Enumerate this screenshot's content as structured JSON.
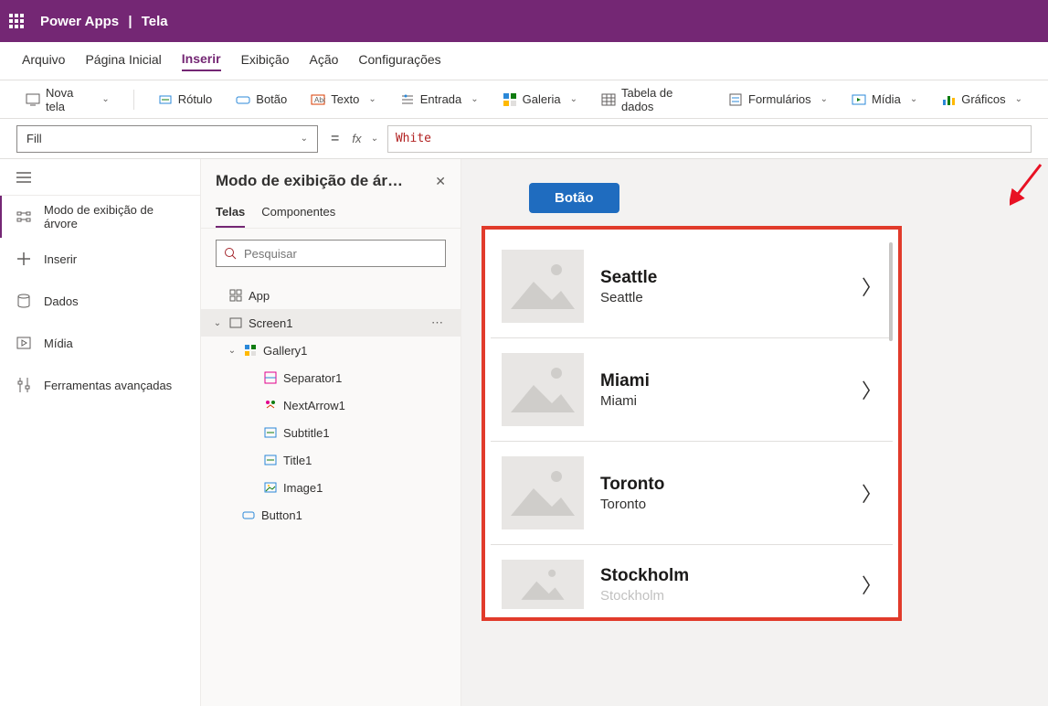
{
  "header": {
    "app_name": "Power Apps",
    "separator": "|",
    "page_name": "Tela"
  },
  "menubar": {
    "items": [
      "Arquivo",
      "Página Inicial",
      "Inserir",
      "Exibição",
      "Ação",
      "Configurações"
    ],
    "active_index": 2
  },
  "ribbon": {
    "nova_tela": "Nova tela",
    "rotulo": "Rótulo",
    "botao": "Botão",
    "texto": "Texto",
    "entrada": "Entrada",
    "galeria": "Galeria",
    "tabela": "Tabela de dados",
    "formularios": "Formulários",
    "midia": "Mídia",
    "graficos": "Gráficos"
  },
  "formula": {
    "property": "Fill",
    "fx_label": "fx",
    "value": "White"
  },
  "rail": {
    "items": [
      {
        "label": "Modo de exibição de árvore",
        "icon": "tree"
      },
      {
        "label": "Inserir",
        "icon": "plus"
      },
      {
        "label": "Dados",
        "icon": "cylinder"
      },
      {
        "label": "Mídia",
        "icon": "media"
      },
      {
        "label": "Ferramentas avançadas",
        "icon": "sliders"
      }
    ],
    "active_index": 0
  },
  "tree": {
    "title": "Modo de exibição de ár…",
    "tabs": [
      "Telas",
      "Componentes"
    ],
    "active_tab": 0,
    "search_placeholder": "Pesquisar",
    "nodes": {
      "app": "App",
      "screen1": "Screen1",
      "gallery1": "Gallery1",
      "separator1": "Separator1",
      "nextarrow1": "NextArrow1",
      "subtitle1": "Subtitle1",
      "title1": "Title1",
      "image1": "Image1",
      "button1": "Button1"
    }
  },
  "canvas": {
    "button_label": "Botão",
    "gallery": [
      {
        "title": "Seattle",
        "subtitle": "Seattle"
      },
      {
        "title": "Miami",
        "subtitle": "Miami"
      },
      {
        "title": "Toronto",
        "subtitle": "Toronto"
      },
      {
        "title": "Stockholm",
        "subtitle": "Stockholm"
      }
    ]
  }
}
